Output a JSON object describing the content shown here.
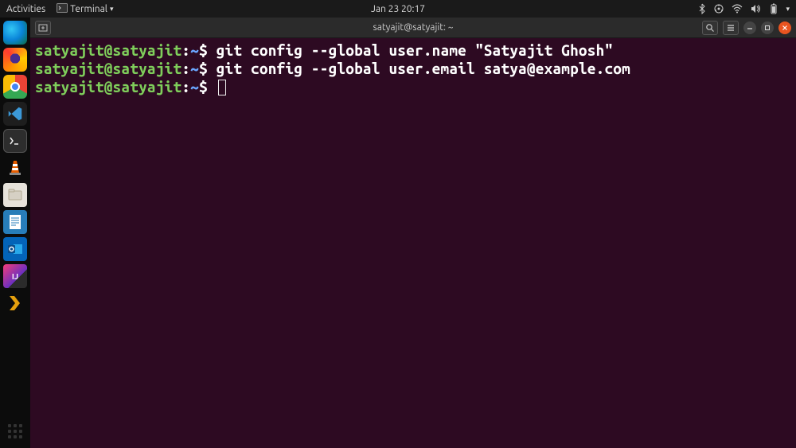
{
  "topbar": {
    "activities_label": "Activities",
    "app_menu_label": "Terminal",
    "clock": "Jan 23  20:17"
  },
  "dock": {
    "items": [
      "edge-icon",
      "firefox-icon",
      "chrome-icon",
      "vscode-icon",
      "terminal-icon",
      "vlc-icon",
      "files-icon",
      "writer-icon",
      "outlook-icon",
      "intellij-icon",
      "plex-icon"
    ]
  },
  "terminal": {
    "titlebar": {
      "title": "satyajit@satyajit: ~",
      "newtab_glyph": "⊞"
    },
    "prompt": {
      "user_host": "satyajit@satyajit",
      "colon": ":",
      "cwd": "~",
      "dollar": "$"
    },
    "lines": [
      {
        "command": "git config --global user.name \"Satyajit Ghosh\""
      },
      {
        "command": "git config --global user.email satya@example.com"
      },
      {
        "command": ""
      }
    ]
  }
}
